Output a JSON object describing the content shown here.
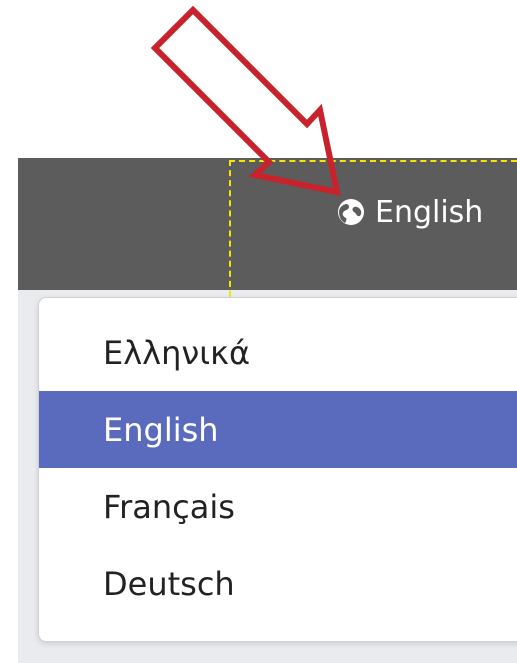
{
  "header": {
    "language_label": "English",
    "language_icon": "globe-icon"
  },
  "dropdown": {
    "items": [
      {
        "label": "Ελληνικά",
        "active": false
      },
      {
        "label": "English",
        "active": true
      },
      {
        "label": "Français",
        "active": false
      },
      {
        "label": "Deutsch",
        "active": false
      }
    ]
  },
  "annotations": {
    "arrow_icon": "arrow-pointer-icon",
    "arrow_color": "#c8232c",
    "highlight_color": "#f4e600"
  },
  "colors": {
    "topbar": "#5c5c5c",
    "active_item": "#5a6bbd"
  }
}
